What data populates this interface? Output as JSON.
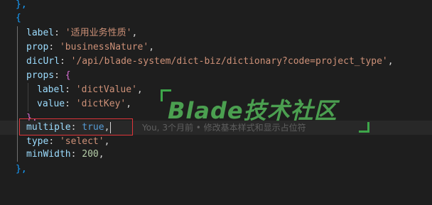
{
  "editor": {
    "lines": [
      {
        "text": "},"
      },
      {
        "text": "{"
      },
      {
        "key": "label",
        "value": "'适用业务性质'"
      },
      {
        "key": "prop",
        "value": "'businessNature'"
      },
      {
        "key": "dicUrl",
        "value": "'/api/blade-system/dict-biz/dictionary?code=project_type'"
      },
      {
        "key": "props",
        "value": "{"
      },
      {
        "key": "label",
        "value": "'dictValue'"
      },
      {
        "key": "value",
        "value": "'dictKey'"
      },
      {
        "text": "},"
      },
      {
        "key": "multiple",
        "value": "true"
      },
      {
        "key": "type",
        "value": "'select'"
      },
      {
        "key": "minWidth",
        "value": "200"
      },
      {
        "text": "},"
      }
    ],
    "blame_annotation": "You, 3个月前 • 修改基本样式和显示占位符"
  },
  "watermark": {
    "text": "Blade技术社区"
  },
  "colors": {
    "background": "#1e1e1e",
    "property": "#9cdcfe",
    "string": "#ce9178",
    "number": "#b5cea8",
    "keyword": "#569cd6",
    "highlight_border": "#e0353a",
    "watermark": "#52b258"
  }
}
